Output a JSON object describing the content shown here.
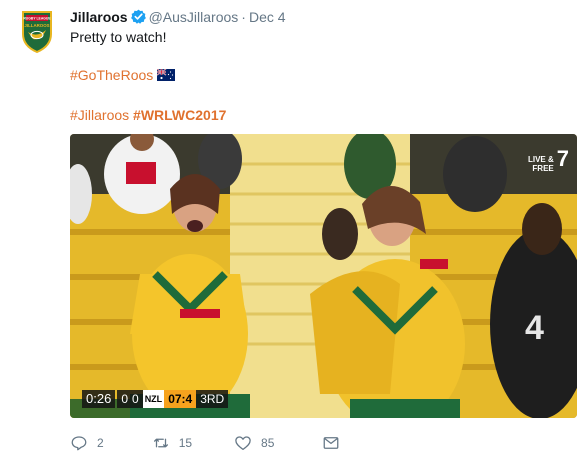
{
  "tweet": {
    "author_name": "Jillaroos",
    "handle": "@AusJillaroos",
    "separator": "·",
    "date": "Dec 4",
    "text_line": "Pretty to watch!",
    "hashtag_1": "#GoTheRoos",
    "hashtag_2": "#Jillaroos",
    "hashtag_3": "#WRLWC2017",
    "hashtag_color": "#e0722f",
    "verified_color": "#1da1f2"
  },
  "avatar": {
    "logo_top_text": "RUGBY LEAGUE",
    "logo_main_text": "JILLAROOS"
  },
  "media": {
    "broadcast_badge": "LIVE & FREE",
    "channel": "7",
    "game_clock": "0:26",
    "score_home": "0",
    "score_away": "0",
    "team_code": "NZL",
    "match_clock": "07:4",
    "period": "3RD",
    "player_number": "4"
  },
  "actions": {
    "reply_count": "2",
    "retweet_count": "15",
    "like_count": "85",
    "icons": [
      "reply-icon",
      "retweet-icon",
      "like-icon",
      "message-icon"
    ]
  }
}
